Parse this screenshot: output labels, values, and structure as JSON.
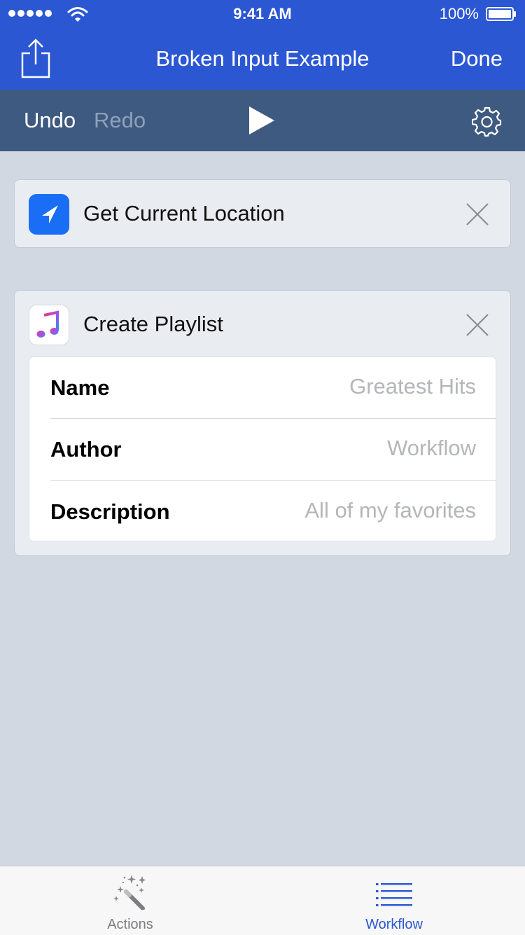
{
  "status_bar": {
    "time": "9:41 AM",
    "battery": "100%"
  },
  "nav": {
    "title": "Broken Input Example",
    "done_label": "Done",
    "share_icon": "share-icon"
  },
  "toolbar": {
    "undo_label": "Undo",
    "redo_label": "Redo",
    "play_icon": "play-icon",
    "settings_icon": "gear-icon"
  },
  "actions": [
    {
      "title": "Get Current Location",
      "icon": "location-arrow-icon",
      "icon_color": "#1a6ef5"
    },
    {
      "title": "Create Playlist",
      "icon": "music-note-icon",
      "params": [
        {
          "label": "Name",
          "placeholder": "Greatest Hits",
          "value": ""
        },
        {
          "label": "Author",
          "placeholder": "Workflow",
          "value": ""
        },
        {
          "label": "Description",
          "placeholder": "All of my favorites",
          "value": ""
        }
      ]
    }
  ],
  "tabs": [
    {
      "label": "Actions",
      "icon": "magic-wand-icon",
      "active": false
    },
    {
      "label": "Workflow",
      "icon": "list-icon",
      "active": true
    }
  ],
  "colors": {
    "accent": "#2b57d3",
    "toolbar": "#3e5a80",
    "background": "#d1d8e2"
  }
}
